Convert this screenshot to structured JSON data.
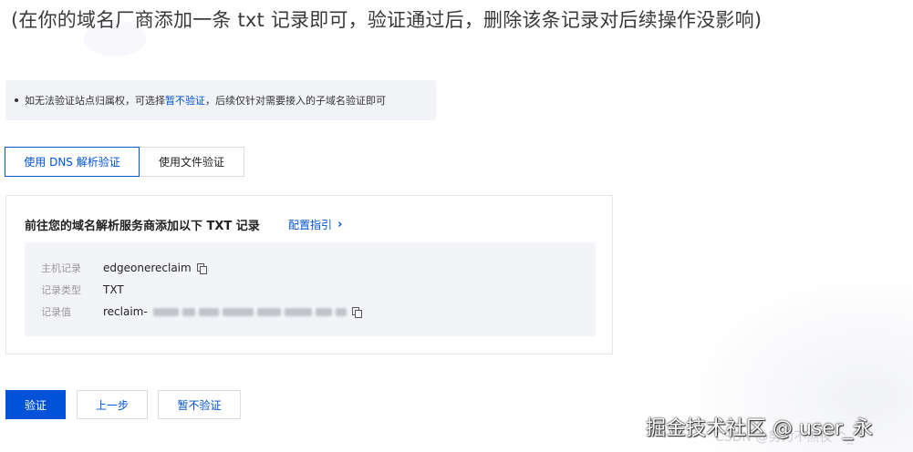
{
  "top_note": "(在你的域名厂商添加一条 txt 记录即可，验证通过后，删除该条记录对后续操作没影响)",
  "info": {
    "before": "如无法验证站点归属权，可选择",
    "link": "暂不验证",
    "after": "，后续仅针对需要接入的子域名验证即可"
  },
  "tabs": [
    {
      "label": "使用 DNS 解析验证",
      "active": true
    },
    {
      "label": "使用文件验证",
      "active": false
    }
  ],
  "card": {
    "title": "前往您的域名解析服务商添加以下 TXT 记录",
    "config_link": "配置指引",
    "records": [
      {
        "label": "主机记录",
        "value": "edgeonereclaim",
        "copyable": true
      },
      {
        "label": "记录类型",
        "value": "TXT",
        "copyable": false
      },
      {
        "label": "记录值",
        "value": "reclaim-",
        "copyable": true,
        "obscured": true
      }
    ]
  },
  "buttons": {
    "verify": "验证",
    "prev": "上一步",
    "skip": "暂不验证"
  },
  "watermark": "掘金技术社区 @ user_永",
  "csdn_watermark": "CSDN @努力不熬夜 ^_^",
  "colors": {
    "accent": "#0052d9",
    "info_bg": "#f1f3f6",
    "record_bg": "#f3f4f7"
  }
}
